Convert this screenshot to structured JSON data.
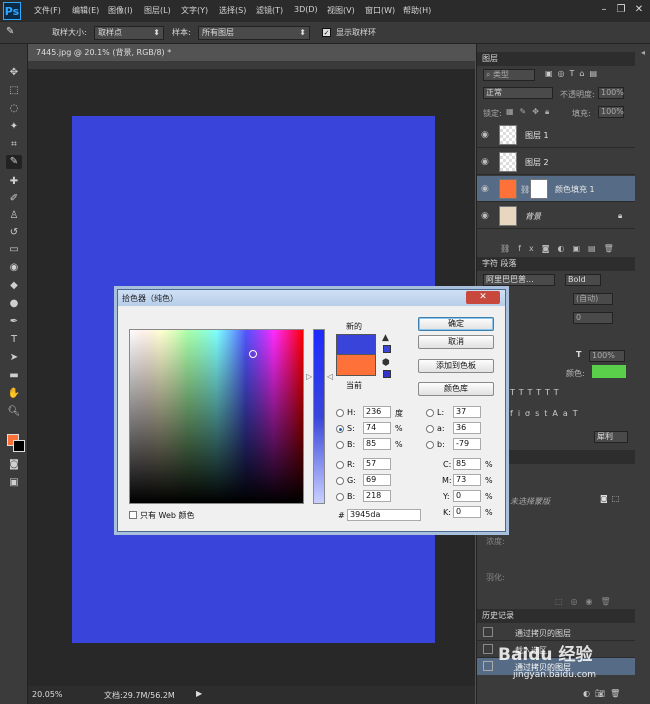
{
  "app": {
    "logo": "Ps"
  },
  "menu": [
    "文件(F)",
    "编辑(E)",
    "图像(I)",
    "图层(L)",
    "文字(Y)",
    "选择(S)",
    "滤镜(T)",
    "3D(D)",
    "视图(V)",
    "窗口(W)",
    "帮助(H)"
  ],
  "options": {
    "sample_size_label": "取样大小:",
    "sample_size": "取样点",
    "sample_label": "样本:",
    "sample": "所有图层",
    "show_ring": "显示取样环"
  },
  "document": {
    "tab": "7445.jpg @ 20.1% (背景, RGB/8) *",
    "zoom": "20.05%",
    "doc_info": "文档:29.7M/56.2M",
    "canvas_color": "#3945da"
  },
  "layers": {
    "tab": "图层",
    "filter": "类型",
    "blend": "正常",
    "opacity_label": "不透明度:",
    "opacity": "100%",
    "lock_label": "锁定:",
    "fill_label": "填充:",
    "fill": "100%",
    "items": [
      {
        "name": "图层 1"
      },
      {
        "name": "图层 2"
      },
      {
        "name": "颜色填充 1",
        "fill": "#fe7138",
        "selected": true
      },
      {
        "name": "背景"
      }
    ]
  },
  "character": {
    "tab1": "字符",
    "tab2": "段落",
    "font": "阿里巴巴普...",
    "style": "Bold",
    "leading": "(自动)",
    "color_label": "颜色:",
    "color": "#5ad04a",
    "scale": "100%",
    "tracking": "0",
    "aa": "犀利"
  },
  "properties": {
    "tab": "属性",
    "no_props": "未选择蒙版",
    "density": "浓度:",
    "feather": "羽化:"
  },
  "history": {
    "tab": "历史记录",
    "items": [
      "通过拷贝的图层",
      "载入选区",
      "通过拷贝的图层"
    ]
  },
  "picker": {
    "title": "拾色器（纯色）",
    "ok": "确定",
    "cancel": "取消",
    "add_swatch": "添加到色板",
    "libraries": "颜色库",
    "new_label": "新的",
    "current_label": "当前",
    "new_color": "#3945da",
    "current_color": "#fe7138",
    "fields": {
      "H": "236",
      "H_unit": "度",
      "S": "74",
      "S_unit": "%",
      "Bv": "85",
      "Bv_unit": "%",
      "R": "57",
      "G": "69",
      "B": "218",
      "L": "37",
      "a": "36",
      "b": "-79",
      "C": "85",
      "M": "73",
      "Y": "0",
      "K": "0",
      "CMYK_unit": "%",
      "hex": "3945da"
    },
    "web_only": "只有 Web 颜色"
  },
  "watermark": {
    "text": "Baidu 经验",
    "sub": "jingyan.baidu.com"
  }
}
